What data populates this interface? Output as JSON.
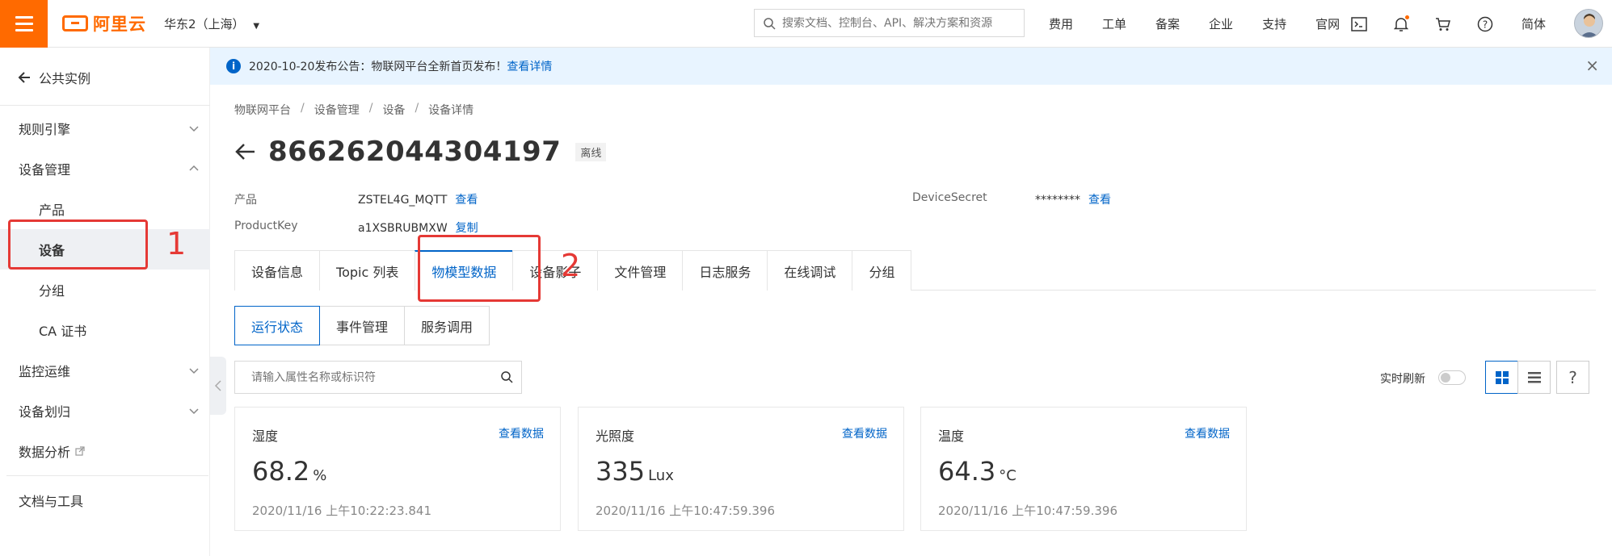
{
  "topbar": {
    "brand": "阿里云",
    "region": "华东2（上海）",
    "search_placeholder": "搜索文档、控制台、API、解决方案和资源",
    "nav": [
      "费用",
      "工单",
      "备案",
      "企业",
      "支持",
      "官网"
    ],
    "lang": "简体"
  },
  "sidebar": {
    "back_label": "公共实例",
    "items": [
      {
        "label": "规则引擎"
      },
      {
        "label": "设备管理"
      },
      {
        "label": "产品"
      },
      {
        "label": "设备"
      },
      {
        "label": "分组"
      },
      {
        "label": "CA 证书"
      },
      {
        "label": "监控运维"
      },
      {
        "label": "设备划归"
      },
      {
        "label": "数据分析"
      },
      {
        "label": "文档与工具"
      }
    ]
  },
  "notice": {
    "text": "2020-10-20发布公告：物联网平台全新首页发布！",
    "link": "查看详情"
  },
  "breadcrumb": [
    "物联网平台",
    "设备管理",
    "设备",
    "设备详情"
  ],
  "device": {
    "name": "866262044304197",
    "status": "离线",
    "product_label": "产品",
    "product_value": "ZSTEL4G_MQTT",
    "product_link": "查看",
    "productkey_label": "ProductKey",
    "productkey_value": "a1XSBRUBMXW",
    "productkey_link": "复制",
    "secret_label": "DeviceSecret",
    "secret_value": "********",
    "secret_link": "查看"
  },
  "tabs": [
    "设备信息",
    "Topic 列表",
    "物模型数据",
    "设备影子",
    "文件管理",
    "日志服务",
    "在线调试",
    "分组"
  ],
  "subtabs": [
    "运行状态",
    "事件管理",
    "服务调用"
  ],
  "prop_search_placeholder": "请输入属性名称或标识符",
  "realtime_refresh_label": "实时刷新",
  "help_label": "?",
  "cards": [
    {
      "name": "湿度",
      "link": "查看数据",
      "value": "68.2",
      "unit": "%",
      "time": "2020/11/16 上午10:22:23.841"
    },
    {
      "name": "光照度",
      "link": "查看数据",
      "value": "335",
      "unit": "Lux",
      "time": "2020/11/16 上午10:47:59.396"
    },
    {
      "name": "温度",
      "link": "查看数据",
      "value": "64.3",
      "unit": "°C",
      "time": "2020/11/16 上午10:47:59.396"
    }
  ],
  "annotations": [
    "1",
    "2"
  ],
  "colors": {
    "accent": "#ff6a00",
    "primary": "#0064c8",
    "highlight": "#e53935"
  }
}
